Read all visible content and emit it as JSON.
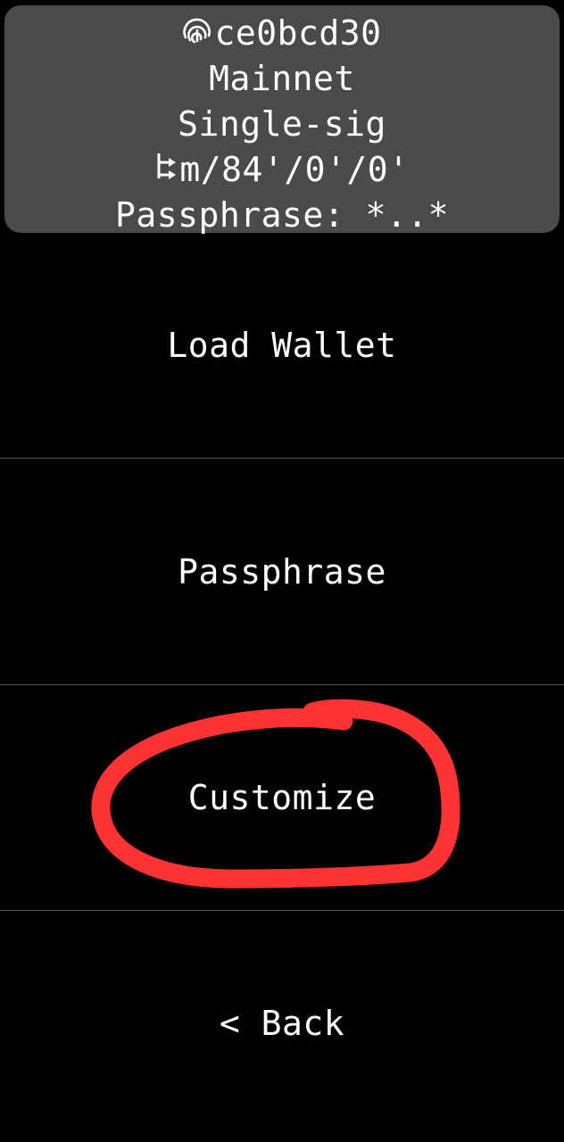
{
  "wallet_info": {
    "fingerprint": "ce0bcd30",
    "fingerprint_icon": "fingerprint-icon",
    "network": "Mainnet",
    "script_type": "Single-sig",
    "derivation_path": "m/84'/0'/0'",
    "derivation_icon": "derivation-path-icon",
    "passphrase": "Passphrase: *..*"
  },
  "menu": {
    "items": [
      {
        "label": "Load Wallet"
      },
      {
        "label": "Passphrase"
      },
      {
        "label": "Customize"
      },
      {
        "label": "< Back"
      }
    ]
  },
  "colors": {
    "background": "#000000",
    "panel": "#4a4a4a",
    "divider": "#555555",
    "text": "#ffffff",
    "annotation": "#ff3333"
  }
}
